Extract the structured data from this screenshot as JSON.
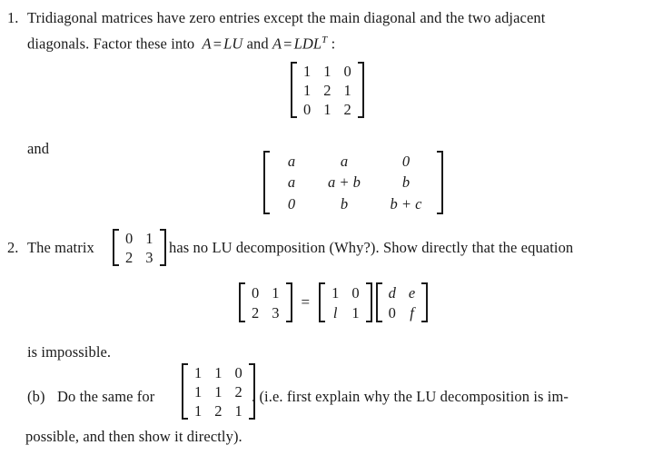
{
  "document": {
    "type": "math-problem-set",
    "background_color": "#ffffff",
    "text_color": "#1a1a1a"
  },
  "problems": [
    {
      "number": "1.",
      "line1": "Tridiagonal matrices have zero entries except the main diagonal and the two adjacent",
      "line2_prefix": "diagonals.  Factor these into",
      "formula_A1": "A",
      "formula_eq1": "=",
      "formula_LU": "LU",
      "formula_and": "and",
      "formula_A2": "A",
      "formula_eq2": "=",
      "formula_LDL": "LDL",
      "formula_T": "T",
      "formula_colon": ":",
      "matrix1": {
        "name": "tridiagonal-numeric-matrix",
        "rows": [
          [
            "1",
            "1",
            "0"
          ],
          [
            "1",
            "2",
            "1"
          ],
          [
            "0",
            "1",
            "2"
          ]
        ]
      },
      "and_label": "and",
      "matrix2": {
        "name": "tridiagonal-symbolic-matrix",
        "rows": [
          [
            "a",
            "a",
            "0"
          ],
          [
            "a",
            "a + b",
            "b"
          ],
          [
            "0",
            "b",
            "b + c"
          ]
        ]
      }
    },
    {
      "number": "2.",
      "line1_prefix": "The matrix",
      "inline_matrix": {
        "name": "matrix-0123",
        "rows": [
          [
            "0",
            "1"
          ],
          [
            "2",
            "3"
          ]
        ]
      },
      "line1_suffix": "has no LU decomposition (Why?).  Show directly that the equation",
      "equation": {
        "name": "lu-equation",
        "lhs": {
          "rows": [
            [
              "0",
              "1"
            ],
            [
              "2",
              "3"
            ]
          ]
        },
        "equals": "=",
        "rhs_L": {
          "rows": [
            [
              "1",
              "0"
            ],
            [
              "l",
              "1"
            ]
          ]
        },
        "rhs_U": {
          "rows": [
            [
              "d",
              "e"
            ],
            [
              "0",
              "f"
            ]
          ]
        }
      },
      "impossible_line": "is impossible.",
      "subpart": {
        "label": "(b)",
        "prefix": "Do the same for",
        "matrix": {
          "name": "matrix-110-112-121",
          "rows": [
            [
              "1",
              "1",
              "0"
            ],
            [
              "1",
              "1",
              "2"
            ],
            [
              "1",
              "2",
              "1"
            ]
          ]
        },
        "suffix": ".  (i.e.  first explain why the LU decomposition is im-",
        "continuation": "possible, and then show it directly)."
      }
    }
  ]
}
